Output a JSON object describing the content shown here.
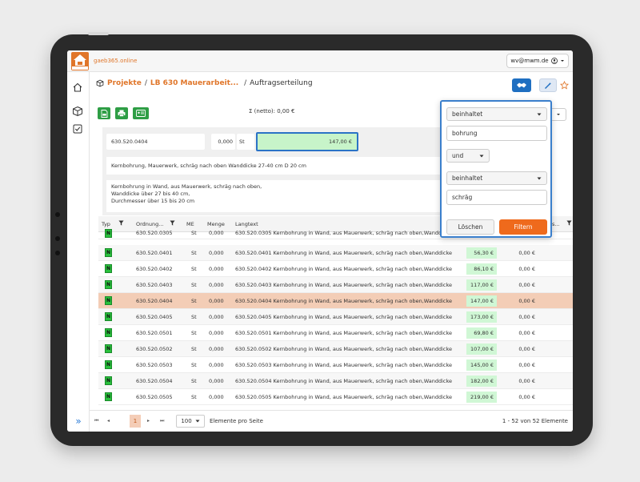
{
  "app": {
    "brand": "gaeb365.online",
    "logo_label": "GAEB"
  },
  "user": {
    "email": "wv@mwm.de"
  },
  "breadcrumb": {
    "root": "Projekte",
    "project": "LB 630 Mauerarbeit...",
    "current": "Auftragserteilung"
  },
  "toolbar": {
    "total": "Σ (netto): 0,00 €"
  },
  "detail": {
    "ordnungszahl": "630.520.0404",
    "menge": "0,000",
    "einheit": "St",
    "preis": "147,00 €",
    "kurztext": "Kernbohrung, Mauerwerk, schräg nach oben Wanddicke 27-40 cm D 20 cm",
    "langtext_line1": "Kernbohrung in Wand, aus Mauerwerk, schräg nach oben,",
    "langtext_line2": "Wanddicke über 27 bis 40 cm,",
    "langtext_line3": "Durchmesser über 15 bis 20 cm"
  },
  "grid": {
    "headers": {
      "typ": "Typ",
      "oz": "Ordnung...",
      "me": "ME",
      "menge": "Menge",
      "langtext": "Langtext",
      "extra": "s..."
    },
    "rows": [
      {
        "typ": "N",
        "oz": "630.520.0305",
        "me": "St",
        "menge": "0,000",
        "text": "630.520.0305 Kernbohrung in Wand, aus Mauerwerk, schräg nach oben,Wanddicke",
        "ep": "",
        "gp": ""
      },
      {
        "typ": "N",
        "oz": "630.520.0401",
        "me": "St",
        "menge": "0,000",
        "text": "630.520.0401 Kernbohrung in Wand, aus Mauerwerk, schräg nach oben,Wanddicke",
        "ep": "56,30 €",
        "gp": "0,00 €"
      },
      {
        "typ": "N",
        "oz": "630.520.0402",
        "me": "St",
        "menge": "0,000",
        "text": "630.520.0402 Kernbohrung in Wand, aus Mauerwerk, schräg nach oben,Wanddicke",
        "ep": "86,10 €",
        "gp": "0,00 €"
      },
      {
        "typ": "N",
        "oz": "630.520.0403",
        "me": "St",
        "menge": "0,000",
        "text": "630.520.0403 Kernbohrung in Wand, aus Mauerwerk, schräg nach oben,Wanddicke",
        "ep": "117,00 €",
        "gp": "0,00 €"
      },
      {
        "typ": "N",
        "oz": "630.520.0404",
        "me": "St",
        "menge": "0,000",
        "text": "630.520.0404 Kernbohrung in Wand, aus Mauerwerk, schräg nach oben,Wanddicke",
        "ep": "147,00 €",
        "gp": "0,00 €"
      },
      {
        "typ": "N",
        "oz": "630.520.0405",
        "me": "St",
        "menge": "0,000",
        "text": "630.520.0405 Kernbohrung in Wand, aus Mauerwerk, schräg nach oben,Wanddicke",
        "ep": "173,00 €",
        "gp": "0,00 €"
      },
      {
        "typ": "N",
        "oz": "630.520.0501",
        "me": "St",
        "menge": "0,000",
        "text": "630.520.0501 Kernbohrung in Wand, aus Mauerwerk, schräg nach oben,Wanddicke",
        "ep": "69,80 €",
        "gp": "0,00 €"
      },
      {
        "typ": "N",
        "oz": "630.520.0502",
        "me": "St",
        "menge": "0,000",
        "text": "630.520.0502 Kernbohrung in Wand, aus Mauerwerk, schräg nach oben,Wanddicke",
        "ep": "107,00 €",
        "gp": "0,00 €"
      },
      {
        "typ": "N",
        "oz": "630.520.0503",
        "me": "St",
        "menge": "0,000",
        "text": "630.520.0503 Kernbohrung in Wand, aus Mauerwerk, schräg nach oben,Wanddicke",
        "ep": "145,00 €",
        "gp": "0,00 €"
      },
      {
        "typ": "N",
        "oz": "630.520.0504",
        "me": "St",
        "menge": "0,000",
        "text": "630.520.0504 Kernbohrung in Wand, aus Mauerwerk, schräg nach oben,Wanddicke",
        "ep": "182,00 €",
        "gp": "0,00 €"
      },
      {
        "typ": "N",
        "oz": "630.520.0505",
        "me": "St",
        "menge": "0,000",
        "text": "630.520.0505 Kernbohrung in Wand, aus Mauerwerk, schräg nach oben,Wanddicke",
        "ep": "219,00 €",
        "gp": "0,00 €"
      }
    ]
  },
  "filter": {
    "op1": "beinhaltet",
    "value1": "bohrung",
    "logic": "und",
    "op2": "beinhaltet",
    "value2": "schräg",
    "clear_label": "Löschen",
    "apply_label": "Filtern"
  },
  "pager": {
    "current": "1",
    "page_size": "100",
    "page_size_label": "Elemente pro Seite",
    "summary": "1 - 52 von 52 Elemente"
  },
  "colors": {
    "accent": "#e0762a",
    "primary": "#2b73c6",
    "green": "#2e9e45",
    "selected_row": "#f3cdb6"
  }
}
